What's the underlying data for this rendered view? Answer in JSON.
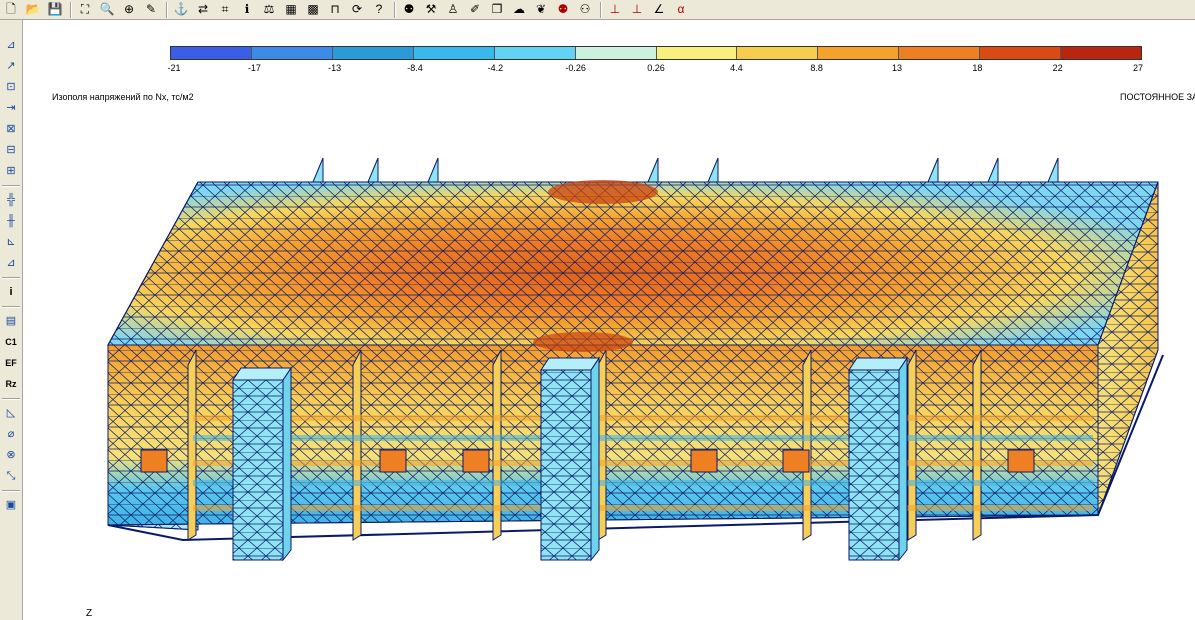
{
  "toolbar": {
    "buttons": [
      {
        "name": "new-file-icon",
        "glyph": "🗋"
      },
      {
        "name": "open-folder-icon",
        "glyph": "📂"
      },
      {
        "name": "save-icon",
        "glyph": "💾"
      },
      {
        "sep": true
      },
      {
        "name": "fit-view-icon",
        "glyph": "⛶"
      },
      {
        "name": "zoom-icon",
        "glyph": "🔍"
      },
      {
        "name": "zoom-window-icon",
        "glyph": "⊕"
      },
      {
        "name": "pencil-icon",
        "glyph": "✎"
      },
      {
        "sep": true
      },
      {
        "name": "anchor-icon",
        "glyph": "⚓"
      },
      {
        "name": "nodes-select-icon",
        "glyph": "⇄"
      },
      {
        "name": "elements-select-icon",
        "glyph": "⌗"
      },
      {
        "name": "info-icon",
        "glyph": "ℹ"
      },
      {
        "name": "scale-icon",
        "glyph": "⚖"
      },
      {
        "name": "grid-fill-icon",
        "glyph": "▦"
      },
      {
        "name": "grid-select-icon",
        "glyph": "▩"
      },
      {
        "name": "frame-icon",
        "glyph": "⊓"
      },
      {
        "name": "refresh-icon",
        "glyph": "⟳"
      },
      {
        "name": "help-cursor-icon",
        "glyph": "?"
      },
      {
        "sep": true
      },
      {
        "name": "weight-icon",
        "glyph": "⚉"
      },
      {
        "name": "load-case-icon",
        "glyph": "⚒"
      },
      {
        "name": "walk-icon",
        "glyph": "♙"
      },
      {
        "name": "load-edit-icon",
        "glyph": "✐"
      },
      {
        "name": "load-copy-icon",
        "glyph": "❐"
      },
      {
        "name": "cloud-icon",
        "glyph": "☁"
      },
      {
        "name": "leaf-icon",
        "glyph": "❦"
      },
      {
        "name": "weight-red-icon",
        "glyph": "⚉"
      },
      {
        "name": "weight-gray-icon",
        "glyph": "⚇"
      },
      {
        "sep": true
      },
      {
        "name": "support-z-icon",
        "glyph": "⊥"
      },
      {
        "name": "support-xz-icon",
        "glyph": "⊥"
      },
      {
        "name": "axes-icon",
        "glyph": "∠"
      },
      {
        "name": "alpha-icon",
        "glyph": "α"
      }
    ]
  },
  "left_toolbar": {
    "buttons": [
      {
        "name": "node-coords-icon",
        "glyph": "⊿"
      },
      {
        "name": "node-move-icon",
        "glyph": "↗"
      },
      {
        "name": "node-add-icon",
        "glyph": "⊡"
      },
      {
        "name": "node-arrow-icon",
        "glyph": "⇥"
      },
      {
        "name": "node-link-icon",
        "glyph": "⊠"
      },
      {
        "name": "node-copy-icon",
        "glyph": "⊟"
      },
      {
        "name": "node-merge-icon",
        "glyph": "⊞"
      },
      {
        "sep": true
      },
      {
        "name": "mesh-icon",
        "glyph": "╬"
      },
      {
        "name": "mesh-split-icon",
        "glyph": "╫"
      },
      {
        "name": "section-gray-icon",
        "glyph": "⊾"
      },
      {
        "name": "section-gray-2-icon",
        "glyph": "⊿"
      },
      {
        "sep": true
      },
      {
        "name": "info-side-icon",
        "glyph": "i"
      },
      {
        "sep": true
      },
      {
        "name": "table-icon",
        "glyph": "▤"
      },
      {
        "name": "c1-icon",
        "glyph": "C1"
      },
      {
        "name": "ef-icon",
        "glyph": "EF"
      },
      {
        "name": "rz-icon",
        "glyph": "Rz"
      },
      {
        "sep": true
      },
      {
        "name": "angle-icon",
        "glyph": "◺"
      },
      {
        "name": "bar-element-icon",
        "glyph": "⌀"
      },
      {
        "name": "bar-cross-icon",
        "glyph": "⊗"
      },
      {
        "name": "bar-diag-icon",
        "glyph": "⤡"
      },
      {
        "sep": true
      },
      {
        "name": "report-icon",
        "glyph": "▣"
      }
    ]
  },
  "legend": {
    "ticks": [
      "-21",
      "-17",
      "-13",
      "-8.4",
      "-4.2",
      "-0.26",
      "0.26",
      "4.4",
      "8.8",
      "13",
      "18",
      "22",
      "27"
    ],
    "colors": [
      "#3a5fe6",
      "#3d8be8",
      "#2b9ad8",
      "#39b8ec",
      "#62d2f5",
      "#cdf1dc",
      "#f9ef7e",
      "#f7cd4f",
      "#f4a22c",
      "#ef7f23",
      "#d94b12",
      "#b82610"
    ]
  },
  "viewport": {
    "title": "Изополя напряжений по Nx, тс/м2",
    "load_case": "ПОСТОЯННОЕ ЗАГР",
    "axis_label": "Z",
    "axis_arrow": "↑"
  },
  "colors": {
    "panel_bg": "#ece9d8",
    "mesh_line": "#0a1a6a",
    "column_fill": "#8ee4f2"
  }
}
